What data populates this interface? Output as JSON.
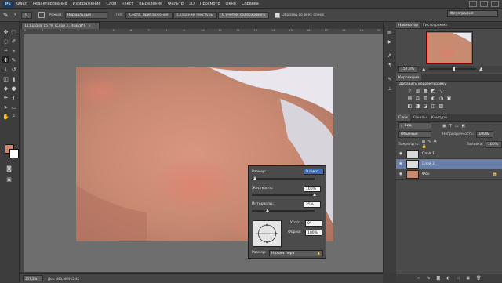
{
  "app": {
    "logo": "Ps"
  },
  "menu": [
    "Файл",
    "Редактирование",
    "Изображение",
    "Слои",
    "Текст",
    "Выделение",
    "Фильтр",
    "3D",
    "Просмотр",
    "Окно",
    "Справка"
  ],
  "options": {
    "brush_size": "9",
    "mode_label": "Режим:",
    "mode_value": "Нормальный",
    "type_label": "Тип:",
    "type_buttons": [
      "Соотв. приближения",
      "Создание текстуры",
      "С учетом содержимого"
    ],
    "sample_all_layers": "Образец со всех слоев",
    "workspace": "Фотография"
  },
  "document": {
    "tab_title": "121.jpg @ 157% (Слой 2, RGB/8*)",
    "ruler_ticks": [
      "0",
      "1",
      "2",
      "3",
      "4",
      "5",
      "6",
      "7",
      "8",
      "9",
      "10",
      "11",
      "12",
      "13",
      "14",
      "15",
      "16",
      "17",
      "18",
      "19",
      "20"
    ],
    "zoom": "157,3%",
    "doc_size": "Док: 483,9K/965,4K"
  },
  "brush_popup": {
    "size_label": "Размер:",
    "size_value": "9 пикс",
    "hardness_label": "Жесткость:",
    "hardness_value": "100%",
    "hardness": 1.0,
    "spacing_label": "Интервалы:",
    "spacing_value": "25%",
    "spacing": 0.25,
    "angle_label": "Угол:",
    "angle_value": "0°",
    "roundness_label": "Форма:",
    "roundness_value": "100%",
    "pen_size_label": "Размер:",
    "pen_size_value": "Нажим пера"
  },
  "panels": {
    "nav_tabs": [
      "Навигатор",
      "Гистограмма"
    ],
    "nav_zoom": "157,3%",
    "adj_tabs": [
      "Коррекция"
    ],
    "adj_title": "Добавить корректировку",
    "adj_icons_row1": [
      "☼",
      "▥",
      "▦",
      "◩",
      "▽"
    ],
    "adj_icons_row2": [
      "▤",
      "⚖",
      "▧",
      "◐",
      "◑",
      "▣"
    ],
    "adj_icons_row3": [
      "◧",
      "◨",
      "◪",
      "◫",
      "▨"
    ],
    "layers_tabs": [
      "Слои",
      "Каналы",
      "Контуры"
    ],
    "filter_kind": "Вид",
    "blend_mode": "Обычные",
    "opacity_label": "Непрозрачность:",
    "opacity_value": "100%",
    "lock_label": "Закрепить:",
    "fill_label": "Заливка:",
    "fill_value": "100%",
    "layers": [
      {
        "name": "Слой 1",
        "selected": false
      },
      {
        "name": "Слой 2",
        "selected": true
      },
      {
        "name": "Фон",
        "selected": false
      }
    ]
  },
  "colors": {
    "foreground": "#d9826b",
    "background": "#ffffff",
    "accent": "#3b6db8"
  }
}
